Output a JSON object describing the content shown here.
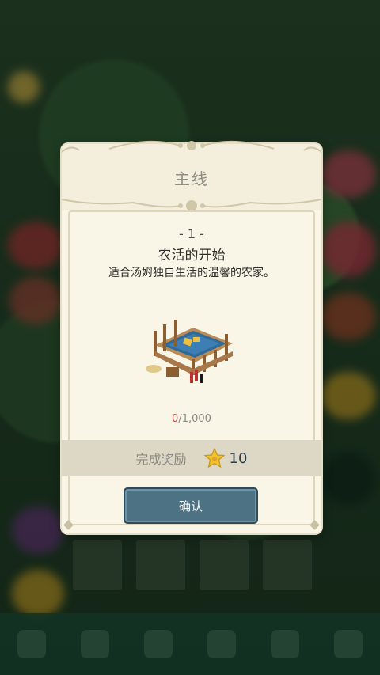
{
  "dialog": {
    "title": "主线",
    "level": "- 1 -",
    "quest_name": "农活的开始",
    "quest_desc": "适合汤姆独自生活的温馨的农家。",
    "progress_current": "0",
    "progress_total": "/1,000",
    "reward_label": "完成奖励",
    "reward_value": "10",
    "reward_icon": "star-icon",
    "confirm_label": "确认"
  },
  "colors": {
    "dialog_bg": "#faf6e7",
    "reward_row_bg": "#ddd8c6",
    "confirm_bg": "#4d7284",
    "progress_current": "#c9474a",
    "star": "#f2c230"
  }
}
